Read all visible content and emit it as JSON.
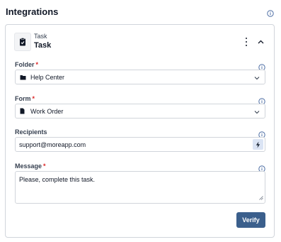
{
  "header": {
    "title": "Integrations"
  },
  "task": {
    "type_label": "Task",
    "name": "Task"
  },
  "fields": {
    "folder": {
      "label": "Folder",
      "required": "*",
      "value": "Help Center"
    },
    "form": {
      "label": "Form",
      "required": "*",
      "value": "Work Order"
    },
    "recipients": {
      "label": "Recipients",
      "value": "support@moreapp.com"
    },
    "message": {
      "label": "Message",
      "required": "*",
      "value": "Please, complete this task."
    }
  },
  "actions": {
    "verify_label": "Verify"
  },
  "icons": {
    "info": "info-circle-icon",
    "task": "clipboard-check-icon",
    "menu": "more-vertical-icon",
    "collapse": "chevron-up-icon",
    "folder": "folder-icon",
    "form": "file-icon",
    "dropdown": "chevron-down-icon",
    "placeholder": "lightning-bolt-icon"
  },
  "colors": {
    "accent": "#3b5f8c",
    "info": "#4f6fa5",
    "required": "#dc2626",
    "bolt_bg": "#dbe4f4"
  }
}
